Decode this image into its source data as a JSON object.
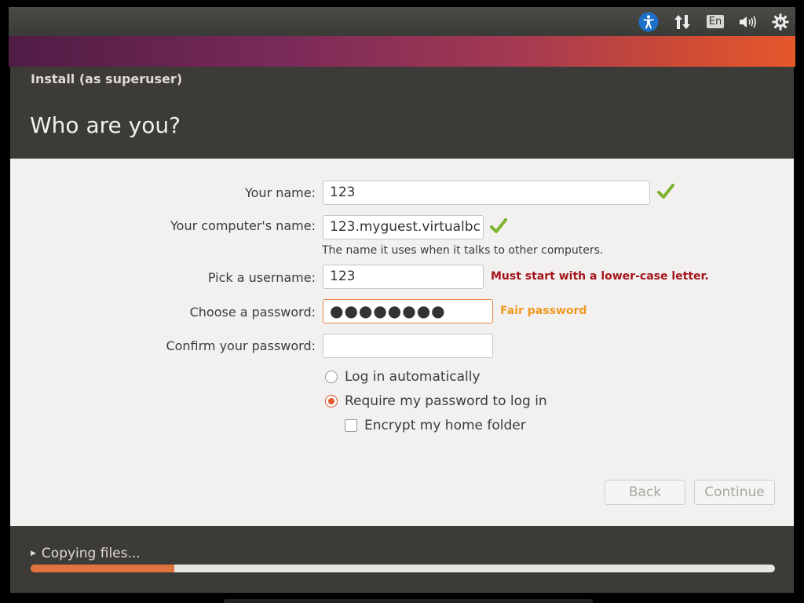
{
  "panel": {
    "indicators": [
      "accessibility-icon",
      "network-updown-icon",
      "keyboard-layout-indicator",
      "volume-icon",
      "gear-power-icon"
    ],
    "keyboard_layout": "En"
  },
  "window": {
    "title": "Install (as superuser)",
    "page_title": "Who are you?"
  },
  "form": {
    "name_label": "Your name:",
    "name_value": "123",
    "computer_label": "Your computer's name:",
    "computer_value": "123.myguest.virtualbc",
    "computer_hint": "The name it uses when it talks to other computers.",
    "username_label": "Pick a username:",
    "username_value": "123",
    "username_error": "Must start with a lower-case letter.",
    "password_label": "Choose a password:",
    "password_value": "●●●●●●●●",
    "password_strength": "Fair password",
    "confirm_label": "Confirm your password:",
    "confirm_value": "",
    "login_auto_label": "Log in automatically",
    "login_auto_selected": false,
    "require_password_label": "Require my password to log in",
    "require_password_selected": true,
    "encrypt_label": "Encrypt my home folder",
    "encrypt_checked": false
  },
  "buttons": {
    "back_label": "Back",
    "continue_label": "Continue"
  },
  "status": {
    "copying_label": "Copying files...",
    "progress_fraction": 0.193
  },
  "colors": {
    "accent": "#e0723c",
    "header_bg": "#3c3b37",
    "valid_check": "#7eb32c",
    "error_text": "#a4151b",
    "strength_text": "#ef9a1e"
  }
}
